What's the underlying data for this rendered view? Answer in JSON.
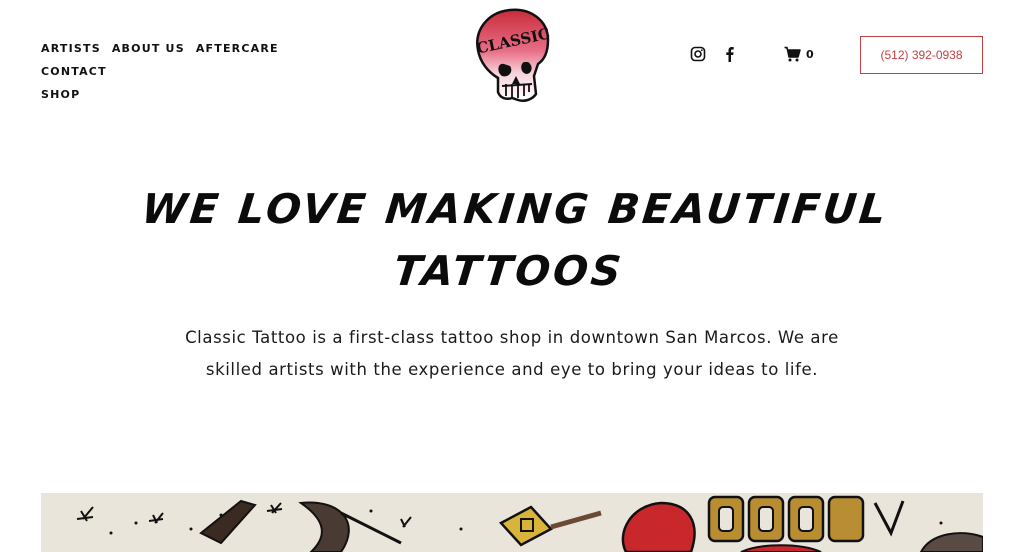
{
  "nav": {
    "items": [
      {
        "label": "ARTISTS"
      },
      {
        "label": "ABOUT US"
      },
      {
        "label": "AFTERCARE"
      },
      {
        "label": "CONTACT"
      },
      {
        "label": "SHOP"
      }
    ]
  },
  "logo": {
    "text": "CLASSIC",
    "icon": "skull-logo"
  },
  "header": {
    "social": [
      {
        "icon": "instagram-icon"
      },
      {
        "icon": "facebook-icon"
      }
    ],
    "cart": {
      "icon": "cart-icon",
      "count": "0"
    },
    "phone": "(512) 392-0938"
  },
  "hero": {
    "title": "We love making beautiful tattoos",
    "description": "Classic Tattoo is a first-class tattoo shop in downtown San Marcos. We are skilled artists with the experience and eye to bring your ideas to life."
  },
  "banner": {
    "image": "tattoo-flash-artwork"
  },
  "colors": {
    "accent": "#c44141",
    "text": "#111111",
    "background": "#ffffff"
  }
}
